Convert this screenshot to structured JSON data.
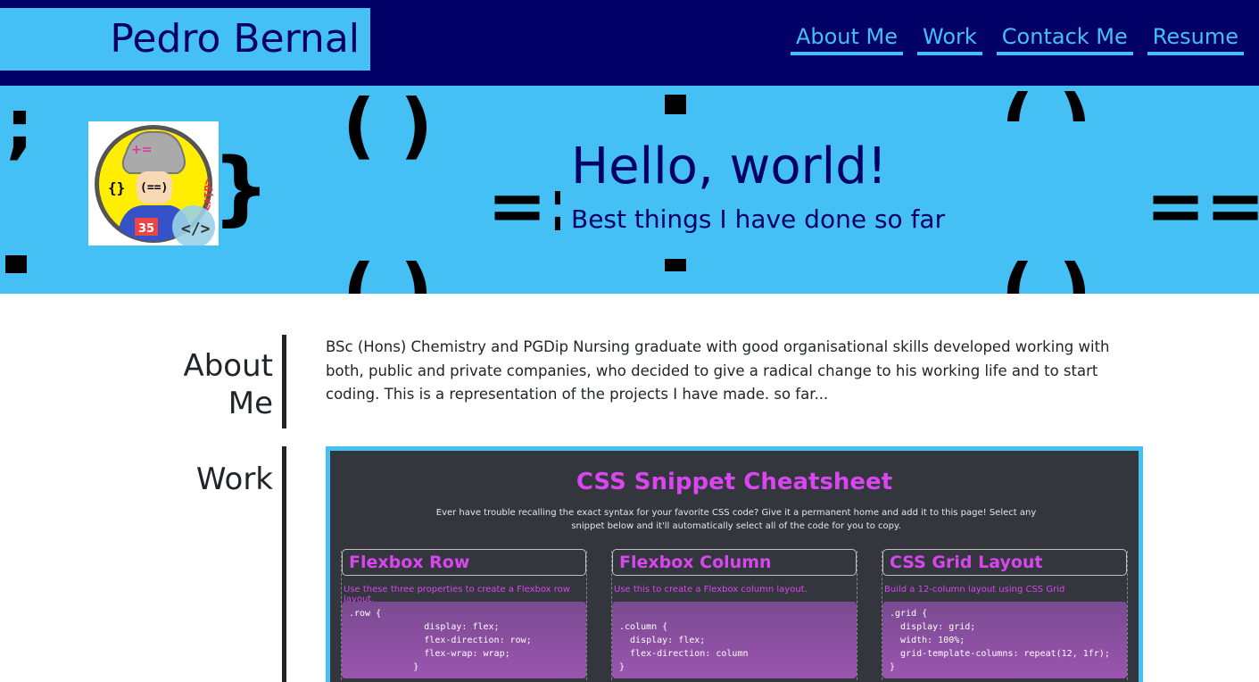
{
  "header": {
    "brand": "Pedro Bernal",
    "nav": [
      "About Me",
      "Work",
      "Contack Me",
      "Resume"
    ]
  },
  "hero": {
    "title": "Hello, world!",
    "subtitle": "Best things I have done so far",
    "background_symbols": [
      ";",
      "}",
      "( )",
      "=:",
      "==",
      "( )"
    ]
  },
  "about": {
    "label": "About Me",
    "label_line1": "About",
    "label_line2": "Me",
    "text": "BSc (Hons) Chemistry and PGDip Nursing graduate with good organisational skills developed working with both, public and private companies, who decided to give a radical change to his working life and to start coding. This is a representation of the projects I have made. so far..."
  },
  "work": {
    "label": "Work",
    "project": {
      "title": "CSS Snippet Cheatsheet",
      "description": "Ever have trouble recalling the exact syntax for your favorite CSS code? Give it a permanent home and add it to this page! Select any snippet below and it'll automatically select all of the code for you to copy.",
      "cards": [
        {
          "title": "Flexbox Row",
          "desc": "Use these three properties to create a Flexbox row layout.",
          "code": ".row {\n              display: flex;\n              flex-direction: row;\n              flex-wrap: wrap;\n            }"
        },
        {
          "title": "Flexbox Column",
          "desc": "Use this to create a Flexbox column layout.",
          "code": "\n.column {\n  display: flex;\n  flex-direction: column\n}"
        },
        {
          "title": "CSS Grid Layout",
          "desc": "Build a 12-column layout using CSS Grid",
          "code": ".grid {\n  display: grid;\n  width: 100%;\n  grid-template-columns: repeat(12, 1fr);\n}"
        }
      ]
    }
  },
  "colors": {
    "navy": "#000066",
    "accent": "#45c0f5",
    "magenta": "#d946ef"
  }
}
